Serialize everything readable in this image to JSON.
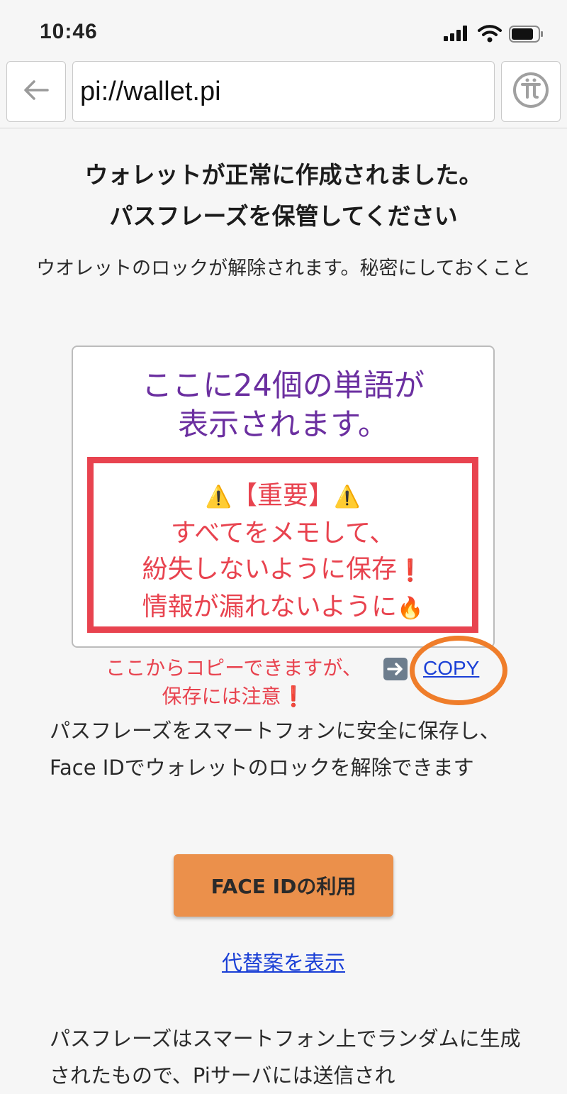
{
  "status_bar": {
    "time": "10:46",
    "signal_icon": "cellular-signal-icon",
    "wifi_icon": "wifi-icon",
    "battery_icon": "battery-icon"
  },
  "nav": {
    "back_icon": "back-arrow-icon",
    "url": "pi://wallet.pi",
    "pi_icon": "pi-logo-icon"
  },
  "title": {
    "line1": "ウォレットが正常に作成されました。",
    "line2": "パスフレーズを保管してください"
  },
  "subtitle": "ウオレットのロックが解除されます。秘密にしておくこと",
  "phrase_box": {
    "line1": "ここに24個の単語が",
    "line2": "表示されます。"
  },
  "warning": {
    "emoji": "⚠️",
    "heading": "【重要】",
    "line1": "すべてをメモして、",
    "line2": "紛失しないように保存",
    "line2_emoji": "❗",
    "line3": "情報が漏れないように",
    "line3_emoji": "🔥"
  },
  "copy_note": {
    "line1": "ここからコピーできますが、",
    "line2": "保存には注意",
    "line2_emoji": "❗",
    "arrow_icon": "right-arrow-icon",
    "copy_label": "COPY"
  },
  "faceid_description": "パスフレーズをスマートフォンに安全に保存し、Face IDでウォレットのロックを解除できます",
  "faceid_button_label": "FACE IDの利用",
  "alt_link_label": "代替案を表示",
  "info_text": "パスフレーズはスマートフォン上でランダムに生成されたもので、Piサーバには送信され",
  "colors": {
    "purple": "#6b2fa0",
    "red": "#e8434f",
    "orange": "#eb904b",
    "link": "#1a3fd6"
  }
}
